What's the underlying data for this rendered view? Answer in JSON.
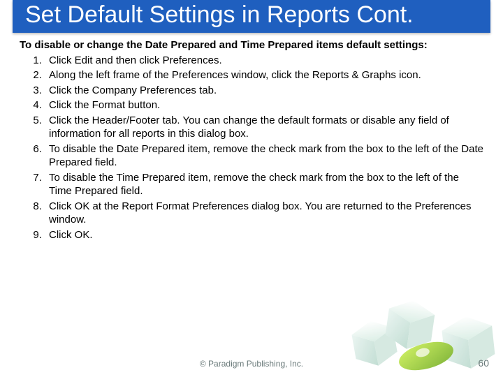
{
  "title": "Set Default Settings in Reports Cont.",
  "intro": "To disable or change the Date Prepared and Time Prepared items default settings:",
  "steps": [
    "Click Edit and then click Preferences.",
    "Along the left frame of the Preferences window, click the Reports & Graphs icon.",
    "Click the Company Preferences tab.",
    "Click the Format button.",
    "Click the Header/Footer tab. You can change the default formats or disable any field of information for all reports in this dialog box.",
    "To disable the Date Prepared item, remove the check mark from the box to the left of the Date Prepared field.",
    "To disable the Time Prepared item, remove the check mark from the box to the left of the Time Prepared field.",
    "Click OK at the Report Format Preferences dialog box. You are returned to the Preferences window.",
    "Click OK."
  ],
  "footer": "© Paradigm Publishing, Inc.",
  "page_number": "60"
}
